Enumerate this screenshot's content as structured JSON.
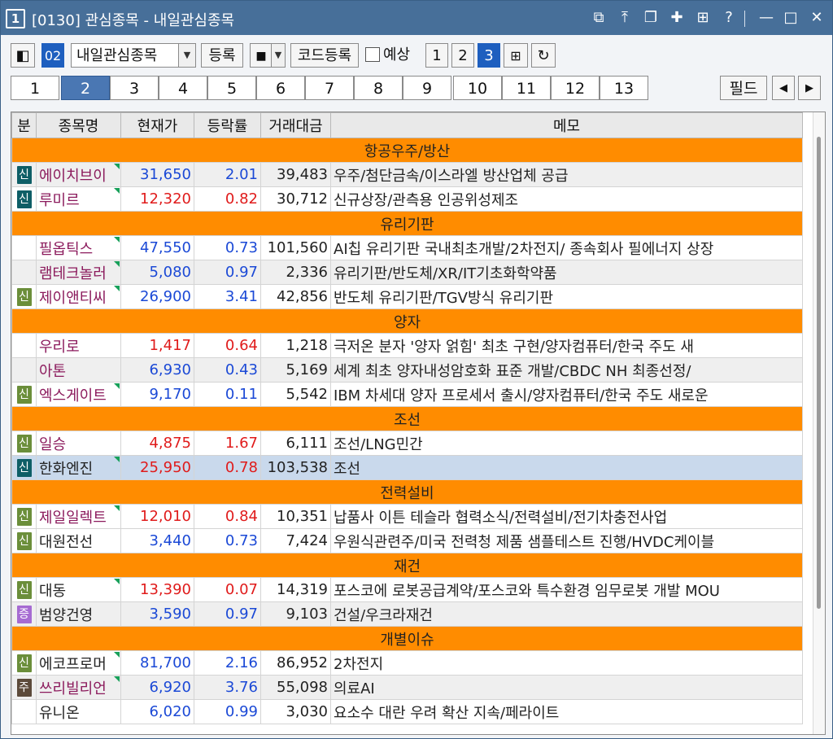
{
  "window": {
    "number": "1",
    "title": "[0130] 관심종목 - 내일관심종목",
    "buttons": [
      "⧉",
      "⤒",
      "⧉",
      "▼",
      "⊞",
      "?",
      "—",
      "□",
      "✕"
    ]
  },
  "toolbar": {
    "group_code": "02",
    "group_name": "내일관심종목",
    "register": "등록",
    "stop_icon": "■",
    "code_register": "코드등록",
    "expect_label": "예상",
    "views": [
      "1",
      "2",
      "3"
    ],
    "active_view": "3"
  },
  "pages": {
    "tabs": [
      "1",
      "2",
      "3",
      "4",
      "5",
      "6",
      "7",
      "8",
      "9",
      "10",
      "11",
      "12",
      "13"
    ],
    "active": "2",
    "field": "필드"
  },
  "columns": [
    "분",
    "종목명",
    "현재가",
    "등락률",
    "거래대금",
    "메모"
  ],
  "colors": {
    "section": "#ff8c00",
    "up": "#e01b1b",
    "down": "#1b49d6",
    "badge_credit": "#3e7a4f",
    "badge_margin": "#0e5e66",
    "badge_stock": "#a66bd2",
    "badge_j": "#5c4a3a"
  },
  "rows": [
    {
      "type": "section",
      "label": "항공우주/방산"
    },
    {
      "type": "row",
      "badge": "신",
      "badge_color": "#0e5e66",
      "name": "에이치브이",
      "price": "31,650",
      "rate": "2.01",
      "dir": "down",
      "volume": "39,483",
      "memo": "우주/첨단금속/이스라엘 방산업체 공급",
      "alt": true,
      "mark": true
    },
    {
      "type": "row",
      "badge": "신",
      "badge_color": "#0e5e66",
      "name": "루미르",
      "price": "12,320",
      "rate": "0.82",
      "dir": "up",
      "volume": "30,712",
      "memo": "신규상장/관측용 인공위성제조",
      "alt": false,
      "mark": true
    },
    {
      "type": "section",
      "label": "유리기판"
    },
    {
      "type": "row",
      "badge": "",
      "name": "필옵틱스",
      "price": "47,550",
      "rate": "0.73",
      "dir": "down",
      "volume": "101,560",
      "memo": "AI칩 유리기판 국내최초개발/2차전지/ 종속회사 필에너지 상장",
      "alt": false,
      "mark": true
    },
    {
      "type": "row",
      "badge": "",
      "name": "램테크놀러",
      "price": "5,080",
      "rate": "0.97",
      "dir": "down",
      "volume": "2,336",
      "memo": "유리기판/반도체/XR/IT기초화학약품",
      "alt": true,
      "mark": true
    },
    {
      "type": "row",
      "badge": "신",
      "badge_color": "#6b8e3a",
      "name": "제이앤티씨",
      "price": "26,900",
      "rate": "3.41",
      "dir": "down",
      "volume": "42,856",
      "memo": "반도체 유리기판/TGV방식 유리기판",
      "alt": false,
      "mark": true
    },
    {
      "type": "section",
      "label": "양자"
    },
    {
      "type": "row",
      "badge": "",
      "name": "우리로",
      "price": "1,417",
      "rate": "0.64",
      "dir": "up",
      "volume": "1,218",
      "memo": "극저온 분자 '양자 얽힘' 최초 구현/양자컴퓨터/한국 주도 새",
      "alt": false,
      "mark": false
    },
    {
      "type": "row",
      "badge": "",
      "name": "아톤",
      "price": "6,930",
      "rate": "0.43",
      "dir": "down",
      "volume": "5,169",
      "memo": "세계 최초 양자내성암호화 표준 개발/CBDC NH 최종선정/",
      "alt": true,
      "mark": false
    },
    {
      "type": "row",
      "badge": "신",
      "badge_color": "#6b8e3a",
      "name": "엑스게이트",
      "price": "9,170",
      "rate": "0.11",
      "dir": "down",
      "volume": "5,542",
      "memo": "IBM 차세대 양자 프로세서 출시/양자컴퓨터/한국 주도 새로운",
      "alt": false,
      "mark": true
    },
    {
      "type": "section",
      "label": "조선"
    },
    {
      "type": "row",
      "badge": "신",
      "badge_color": "#6b8e3a",
      "name": "일승",
      "price": "4,875",
      "rate": "1.67",
      "dir": "up",
      "volume": "6,111",
      "memo": "조선/LNG민간",
      "alt": false,
      "mark": false
    },
    {
      "type": "row",
      "badge": "신",
      "badge_color": "#0e5e66",
      "name": "한화엔진",
      "price": "25,950",
      "rate": "0.78",
      "dir": "up",
      "volume": "103,538",
      "memo": "조선",
      "alt": false,
      "sel": true,
      "dark": true,
      "mark": true
    },
    {
      "type": "section",
      "label": "전력설비"
    },
    {
      "type": "row",
      "badge": "신",
      "badge_color": "#6b8e3a",
      "name": "제일일렉트",
      "price": "12,010",
      "rate": "0.84",
      "dir": "up",
      "volume": "10,351",
      "memo": "납품사 이튼 테슬라 협력소식/전력설비/전기차충전사업",
      "alt": false,
      "mark": true
    },
    {
      "type": "row",
      "badge": "신",
      "badge_color": "#6b8e3a",
      "name": "대원전선",
      "price": "3,440",
      "rate": "0.73",
      "dir": "down",
      "volume": "7,424",
      "memo": "우원식관련주/미국 전력청 제품 샘플테스트 진행/HVDC케이블",
      "alt": false,
      "dark": true,
      "mark": false
    },
    {
      "type": "section",
      "label": "재건"
    },
    {
      "type": "row",
      "badge": "신",
      "badge_color": "#6b8e3a",
      "name": "대동",
      "price": "13,390",
      "rate": "0.07",
      "dir": "up",
      "volume": "14,319",
      "memo": "포스코에 로봇공급계약/포스코와 특수환경 임무로봇 개발 MOU",
      "alt": false,
      "dark": true,
      "mark": true
    },
    {
      "type": "row",
      "badge": "증",
      "badge_color": "#a66bd2",
      "name": "범양건영",
      "price": "3,590",
      "rate": "0.97",
      "dir": "down",
      "volume": "9,103",
      "memo": "건설/우크라재건",
      "alt": true,
      "dark": true,
      "mark": false
    },
    {
      "type": "section",
      "label": "개별이슈"
    },
    {
      "type": "row",
      "badge": "신",
      "badge_color": "#6b8e3a",
      "name": "에코프로머",
      "price": "81,700",
      "rate": "2.16",
      "dir": "down",
      "volume": "86,952",
      "memo": "2차전지",
      "alt": false,
      "dark": true,
      "mark": true
    },
    {
      "type": "row",
      "badge": "주",
      "badge_color": "#5c4a3a",
      "name": "쓰리빌리언",
      "price": "6,920",
      "rate": "3.76",
      "dir": "down",
      "volume": "55,098",
      "memo": "의료AI",
      "alt": true,
      "mark": true
    },
    {
      "type": "row",
      "badge": "",
      "name": "유니온",
      "price": "6,020",
      "rate": "0.99",
      "dir": "down",
      "volume": "3,030",
      "memo": "요소수 대란 우려 확산 지속/페라이트",
      "alt": false,
      "dark": true,
      "mark": false
    }
  ]
}
